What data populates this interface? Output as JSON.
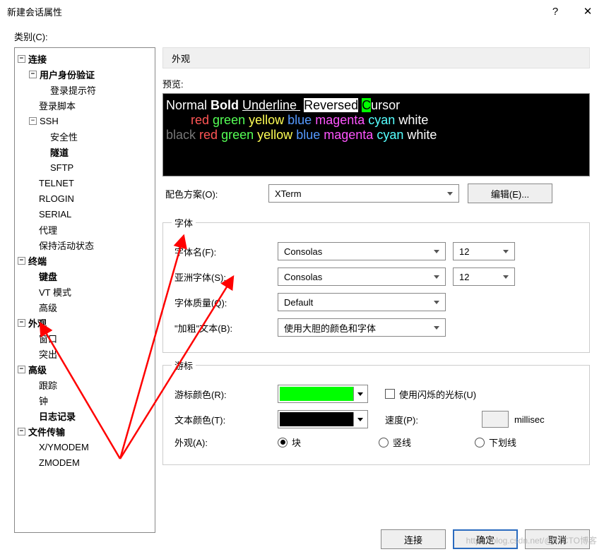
{
  "window": {
    "title": "新建会话属性",
    "help": "?",
    "close": "✕"
  },
  "category_label": "类别(C):",
  "tree": {
    "connection": "连接",
    "auth": "用户身份验证",
    "login_prompt": "登录提示符",
    "login_script": "登录脚本",
    "ssh": "SSH",
    "security": "安全性",
    "tunnel": "隧道",
    "sftp": "SFTP",
    "telnet": "TELNET",
    "rlogin": "RLOGIN",
    "serial": "SERIAL",
    "proxy": "代理",
    "keepalive": "保持活动状态",
    "terminal": "终端",
    "keyboard": "键盘",
    "vt": "VT 模式",
    "advanced1": "高级",
    "appearance": "外观",
    "window": "窗口",
    "highlight": "突出",
    "advanced2": "高级",
    "track": "跟踪",
    "bell": "钟",
    "log": "日志记录",
    "filetransfer": "文件传输",
    "xymodem": "X/YMODEM",
    "zmodem": "ZMODEM"
  },
  "tab": "外观",
  "preview_label": "预览:",
  "preview": {
    "normal": "Normal ",
    "bold": "Bold ",
    "underline": "Underline ",
    "reversed": "Reversed",
    "cursor_c": "C",
    "cursor_rest": "ursor",
    "colors": [
      "red",
      "green",
      "yellow",
      "blue",
      "magenta",
      "cyan",
      "white"
    ],
    "black": "black"
  },
  "scheme": {
    "label": "配色方案(O):",
    "value": "XTerm",
    "edit": "编辑(E)..."
  },
  "font_group": "字体",
  "font_name": {
    "label": "字体名(F):",
    "value": "Consolas",
    "size": "12"
  },
  "asian_font": {
    "label": "亚洲字体(S):",
    "value": "Consolas",
    "size": "12"
  },
  "font_quality": {
    "label": "字体质量(Q):",
    "value": "Default"
  },
  "bold_text": {
    "label": "\"加粗\"文本(B):",
    "value": "使用大胆的颜色和字体"
  },
  "cursor_group": "游标",
  "cursor_color": {
    "label": "游标颜色(R):",
    "value": "#00ff00"
  },
  "blink": "使用闪烁的光标(U)",
  "text_color": {
    "label": "文本颜色(T):",
    "value": "#000000"
  },
  "speed": {
    "label": "速度(P):",
    "unit": "millisec"
  },
  "shape": {
    "label": "外观(A):",
    "block": "块",
    "vbar": "竖线",
    "underline": "下划线"
  },
  "footer": {
    "connect": "连接",
    "ok": "确定",
    "cancel": "取消"
  },
  "watermark": "https://blog.csdn.net/@51CTO博客"
}
